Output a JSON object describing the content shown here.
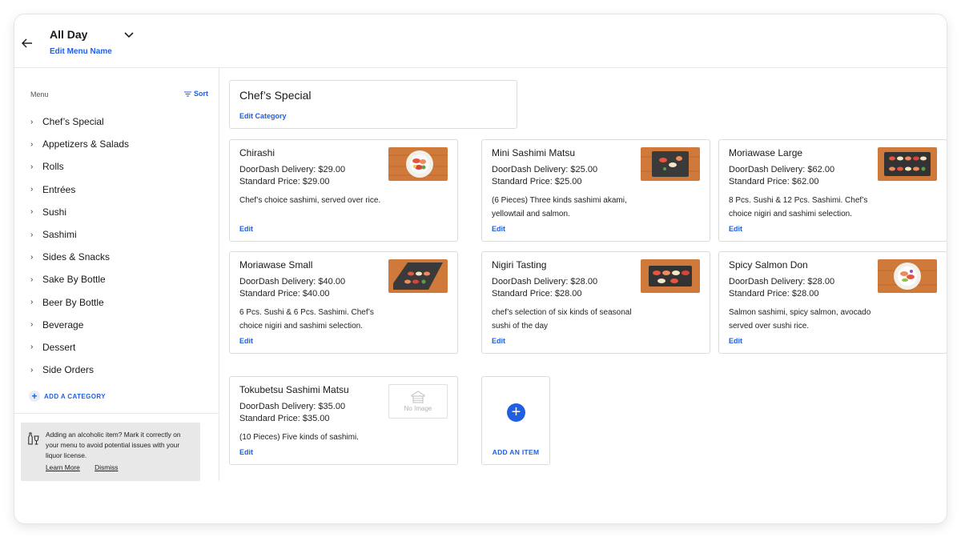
{
  "header": {
    "menu_name": "All Day",
    "edit_menu_name": "Edit Menu Name"
  },
  "sidebar": {
    "title": "Menu",
    "sort_label": "Sort",
    "categories": [
      "Chef’s Special",
      "Appetizers & Salads",
      "Rolls",
      "Entrées",
      "Sushi",
      "Sashimi",
      "Sides & Snacks",
      "Sake By Bottle",
      "Beer By Bottle",
      "Beverage",
      "Dessert",
      "Side Orders"
    ],
    "add_category": "ADD A CATEGORY",
    "notice": {
      "text": "Adding an alcoholic item? Mark it correctly on your menu to avoid potential issues with your liquor license.",
      "learn_more": "Learn More",
      "dismiss": "Dismiss"
    }
  },
  "category": {
    "title": "Chef’s Special",
    "edit_label": "Edit Category"
  },
  "items": [
    {
      "name": "Chirashi",
      "doordash_price": "DoorDash Delivery: $29.00",
      "standard_price": "Standard Price: $29.00",
      "description": "Chef’s choice sashimi, served over rice.",
      "edit": "Edit",
      "image": "bowl"
    },
    {
      "name": "Mini Sashimi Matsu",
      "doordash_price": "DoorDash Delivery: $25.00",
      "standard_price": "Standard Price: $25.00",
      "description": "(6 Pieces) Three kinds sashimi akami, yellowtail and salmon.",
      "edit": "Edit",
      "image": "slate"
    },
    {
      "name": "Moriawase Large",
      "doordash_price": "DoorDash Delivery: $62.00",
      "standard_price": "Standard Price: $62.00",
      "description": "8 Pcs. Sushi & 12 Pcs. Sashimi. Chef’s choice nigiri and sashimi selection.",
      "edit": "Edit",
      "image": "platter"
    },
    {
      "name": "Moriawase Small",
      "doordash_price": "DoorDash Delivery: $40.00",
      "standard_price": "Standard Price: $40.00",
      "description": "6 Pcs. Sushi & 6 Pcs. Sashimi. Chef’s choice nigiri and sashimi selection.",
      "edit": "Edit",
      "image": "platter"
    },
    {
      "name": "Nigiri Tasting",
      "doordash_price": "DoorDash Delivery: $28.00",
      "standard_price": "Standard Price: $28.00",
      "description": "chef’s selection of six kinds of seasonal sushi of the day",
      "edit": "Edit",
      "image": "platter"
    },
    {
      "name": "Spicy Salmon Don",
      "doordash_price": "DoorDash Delivery: $28.00",
      "standard_price": "Standard Price: $28.00",
      "description": "Salmon sashimi, spicy salmon, avocado served over sushi rice.",
      "edit": "Edit",
      "image": "bowl"
    },
    {
      "name": "Tokubetsu Sashimi Matsu",
      "doordash_price": "DoorDash Delivery: $35.00",
      "standard_price": "Standard Price: $35.00",
      "description": "(10 Pieces) Five kinds of sashimi.",
      "edit": "Edit",
      "image": "none",
      "no_image_label": "No Image"
    }
  ],
  "add_item": "ADD AN ITEM",
  "colors": {
    "accent": "#1f5fe0",
    "wood": "#cf7a3a",
    "slate": "#3a3a3a"
  }
}
